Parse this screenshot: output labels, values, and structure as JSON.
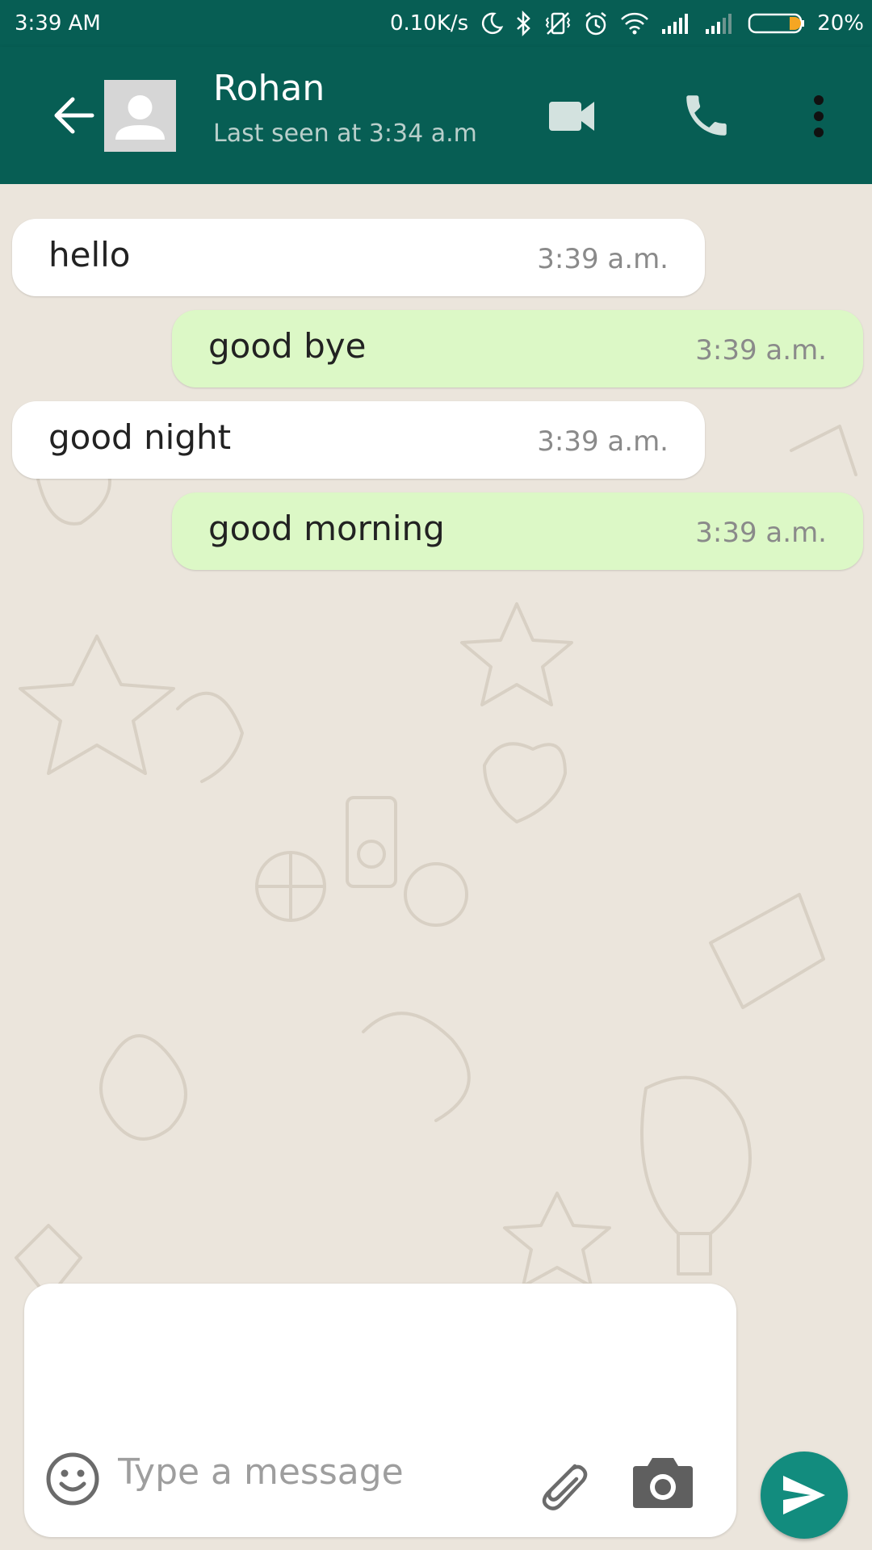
{
  "status_bar": {
    "time": "3:39 AM",
    "net_speed": "0.10K/s",
    "battery": "20%",
    "icons": [
      "moon-icon",
      "bluetooth-icon",
      "vibrate-off-icon",
      "alarm-icon",
      "wifi-icon",
      "signal-icon",
      "signal-icon",
      "battery-icon"
    ]
  },
  "header": {
    "contact_name": "Rohan",
    "last_seen": "Last seen at 3:34 a.m",
    "icons": [
      "back-arrow-icon",
      "avatar-icon",
      "video-call-icon",
      "phone-icon",
      "more-vert-icon"
    ]
  },
  "messages": [
    {
      "direction": "incoming",
      "text": "hello",
      "time": "3:39 a.m."
    },
    {
      "direction": "outgoing",
      "text": "good bye",
      "time": "3:39 a.m."
    },
    {
      "direction": "incoming",
      "text": "good night",
      "time": "3:39 a.m."
    },
    {
      "direction": "outgoing",
      "text": "good morning",
      "time": "3:39 a.m."
    }
  ],
  "input": {
    "placeholder": "Type a message",
    "value": "",
    "icons": [
      "emoji-icon",
      "paperclip-icon",
      "camera-icon",
      "send-icon"
    ]
  },
  "colors": {
    "header": "#075e54",
    "incoming_bubble": "#ffffff",
    "outgoing_bubble": "#dcf8c6",
    "send_button": "#128c7e",
    "chat_background": "#ebe5dc"
  }
}
